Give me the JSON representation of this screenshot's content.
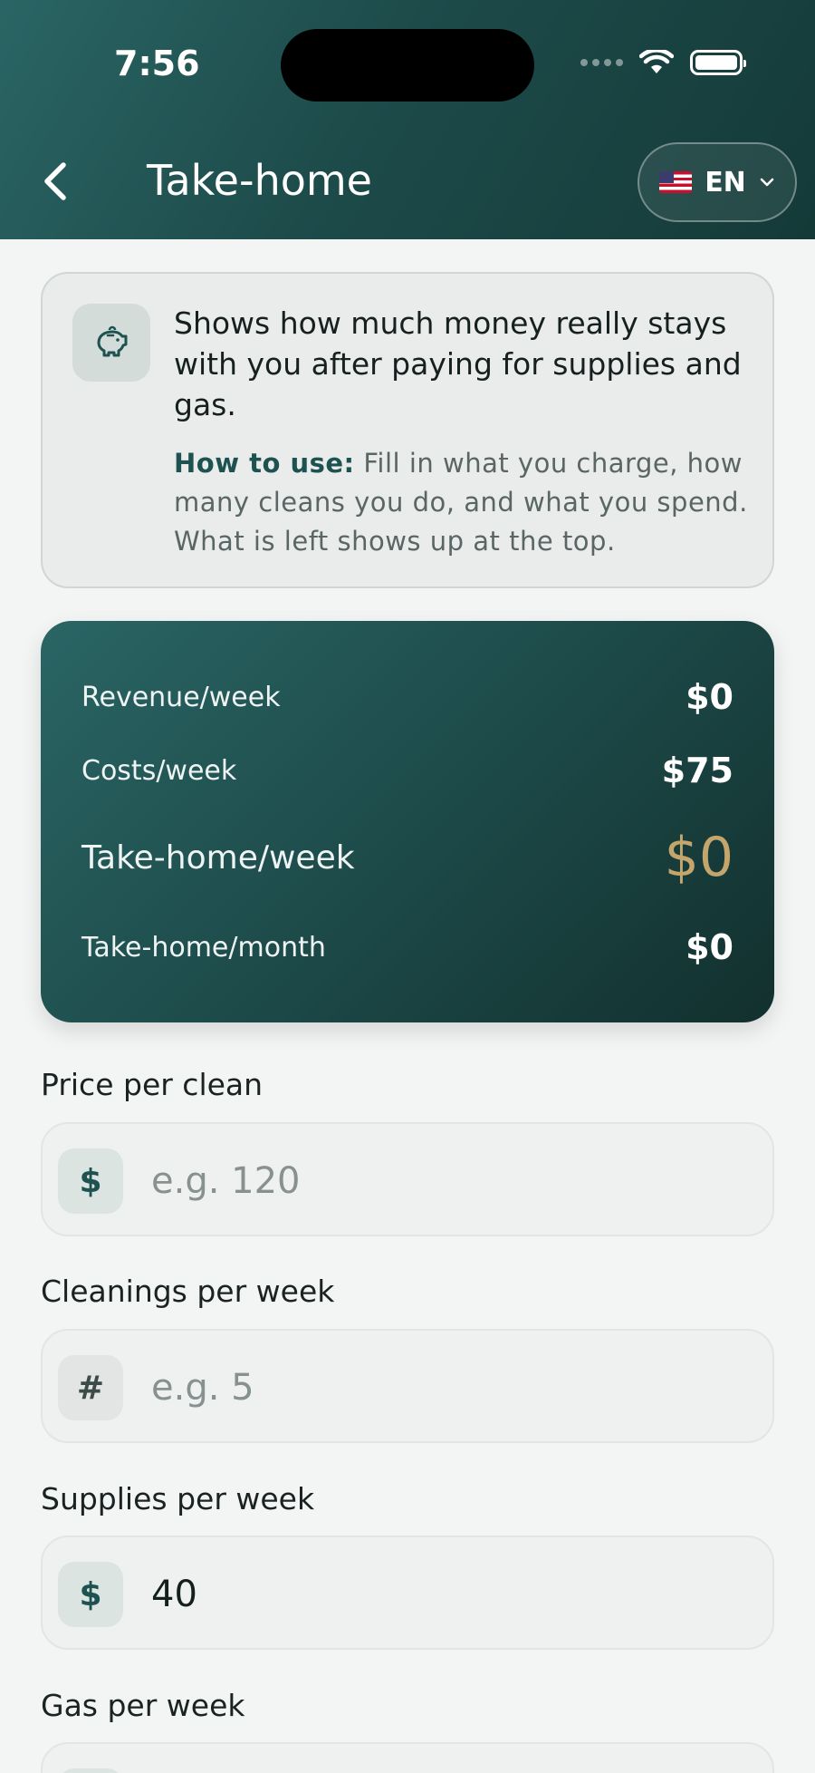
{
  "status_bar": {
    "time": "7:56"
  },
  "header": {
    "title": "Take-home",
    "language": {
      "code": "EN",
      "flag": "us-flag"
    }
  },
  "info_card": {
    "icon": "piggy-bank-icon",
    "description": "Shows how much money really stays with you after paying for supplies and gas.",
    "how_to_label": "How to use:",
    "how_to_text": "Fill in what you charge, how many cleans you do, and what you spend. What is left shows up at the top."
  },
  "summary": {
    "revenue_week": {
      "label": "Revenue/week",
      "value": "$0"
    },
    "costs_week": {
      "label": "Costs/week",
      "value": "$75"
    },
    "takehome_week": {
      "label": "Take-home/week",
      "value": "$0"
    },
    "takehome_month": {
      "label": "Take-home/month",
      "value": "$0"
    }
  },
  "fields": {
    "price_per_clean": {
      "label": "Price per clean",
      "prefix": "$",
      "value": "",
      "placeholder": "e.g. 120"
    },
    "cleanings_per_week": {
      "label": "Cleanings per week",
      "prefix": "#",
      "value": "",
      "placeholder": "e.g. 5"
    },
    "supplies_per_week": {
      "label": "Supplies per week",
      "prefix": "$",
      "value": "40",
      "placeholder": ""
    },
    "gas_per_week": {
      "label": "Gas per week"
    }
  },
  "colors": {
    "header_gradient_start": "#2a6564",
    "header_gradient_end": "#143a38",
    "takehome_accent": "#c4a56c",
    "background": "#f3f5f4"
  }
}
